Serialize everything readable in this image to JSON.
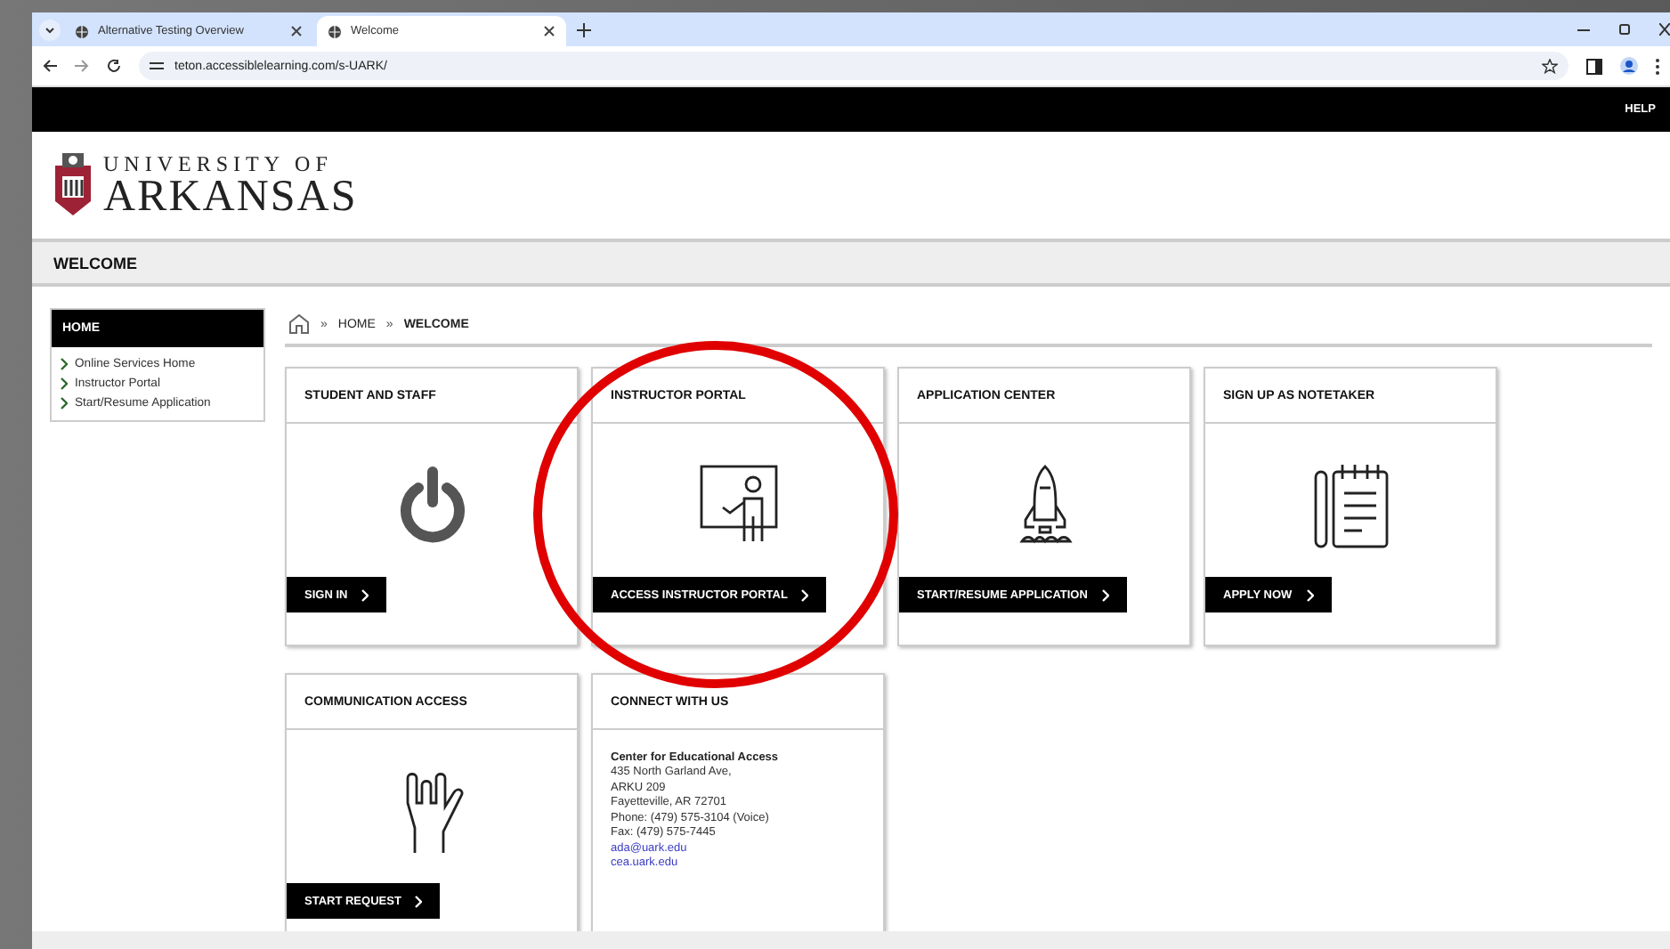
{
  "browser": {
    "tabs": [
      {
        "title": "Alternative Testing Overview",
        "selected": false
      },
      {
        "title": "Welcome",
        "selected": true
      }
    ],
    "url": "teton.accessiblelearning.com/s-UARK/"
  },
  "topbar": {
    "link": "HELP"
  },
  "logo": {
    "line1": "UNIVERSITY OF",
    "line2": "ARKANSAS"
  },
  "page_title": "WELCOME",
  "sidebar": {
    "heading": "HOME",
    "items": [
      "Online Services Home",
      "Instructor Portal",
      "Start/Resume Application"
    ]
  },
  "breadcrumb": {
    "separator": "»",
    "items": [
      {
        "label": "HOME",
        "current": false
      },
      {
        "label": "WELCOME",
        "current": true
      }
    ]
  },
  "cards": [
    {
      "kind": "action",
      "title": "STUDENT AND STAFF",
      "button": "SIGN IN"
    },
    {
      "kind": "action",
      "title": "INSTRUCTOR PORTAL",
      "button": "ACCESS INSTRUCTOR PORTAL"
    },
    {
      "kind": "action",
      "title": "APPLICATION CENTER",
      "button": "START/RESUME APPLICATION"
    },
    {
      "kind": "action",
      "title": "SIGN UP AS NOTETAKER",
      "button": "APPLY NOW"
    },
    {
      "kind": "action",
      "title": "COMMUNICATION ACCESS",
      "button": "START REQUEST"
    },
    {
      "kind": "contact",
      "title": "CONNECT WITH US",
      "org": "Center for Educational Access",
      "lines": [
        "435 North Garland Ave,",
        "ARKU 209",
        "Fayetteville, AR 72701",
        "Phone: (479) 575-3104 (Voice)",
        "Fax: (479) 575-7445"
      ],
      "links": [
        "ada@uark.edu",
        "cea.uark.edu"
      ]
    }
  ]
}
